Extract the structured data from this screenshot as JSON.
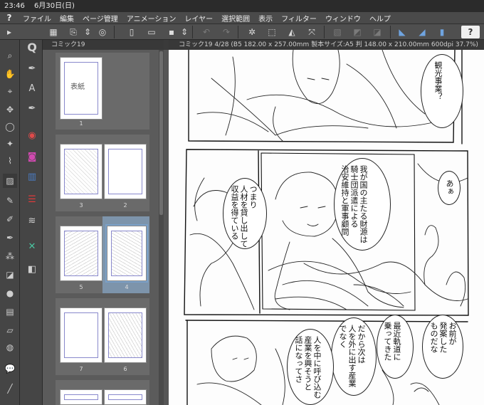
{
  "status_bar": {
    "time": "23:46",
    "date": "6月30日(日)"
  },
  "menu": {
    "items": [
      "ファイル",
      "編集",
      "ページ管理",
      "アニメーション",
      "レイヤー",
      "選択範囲",
      "表示",
      "フィルター",
      "ウィンドウ",
      "ヘルプ"
    ]
  },
  "tabs": {
    "page_panel_tab": "コミック19",
    "canvas_tab": "コミック19 4/28 (B5 182.00 x 257.00mm 製本サイズ:A5 判 148.00 x 210.00mm 600dpi 37.7%)"
  },
  "pages": [
    {
      "label": "1",
      "title_text": "表紙"
    },
    {
      "label": "2"
    },
    {
      "label": "3"
    },
    {
      "label": "4"
    },
    {
      "label": "5"
    },
    {
      "label": "6"
    },
    {
      "label": "7"
    }
  ],
  "balloons": {
    "b1": "観光事業？",
    "b2": "我が国の主たる財源は\n騎士団派遣による\n治安維持と軍事顧問",
    "b3": "つまり\n人材を貸し出して\n収益を得ている",
    "b4": "あぁ",
    "b5": "お前が\n発案した\nものだな",
    "b6": "最近軌道に\n乗ってきた",
    "b7": "だから次は\n人を外に出す産業\nでなく",
    "b8": "人を中に呼び込む\n産業を興そうと\n話になってさ"
  },
  "colors": {
    "selection": "#7aa0c8",
    "accent_blue": "#4a7cc4"
  }
}
